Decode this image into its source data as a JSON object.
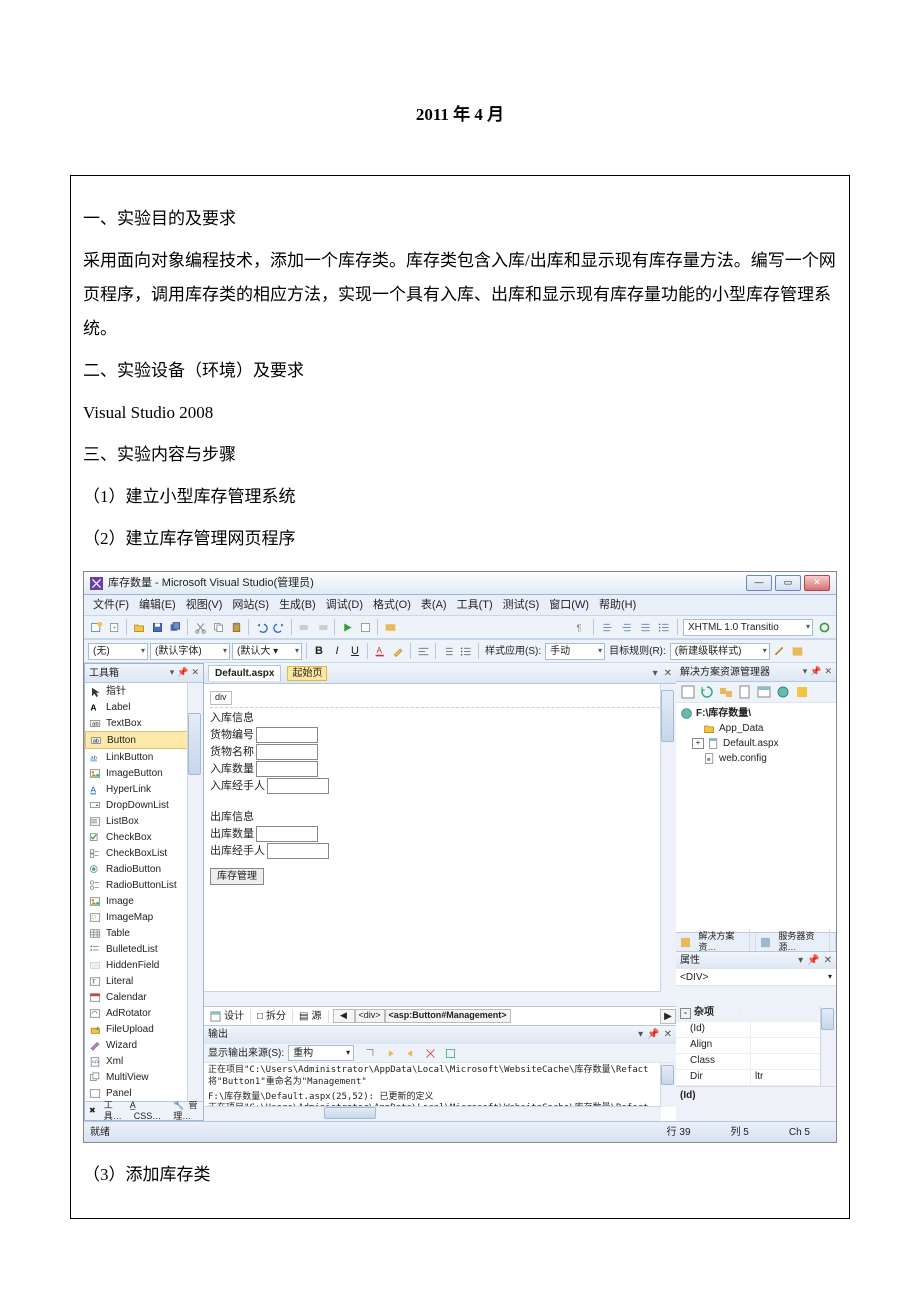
{
  "doc": {
    "date": "2011   年  4    月",
    "h1": "一、实验目的及要求",
    "p1": "采用面向对象编程技术，添加一个库存类。库存类包含入库/出库和显示现有库存量方法。编写一个网页程序，调用库存类的相应方法，实现一个具有入库、出库和显示现有库存量功能的小型库存管理系统。",
    "h2": "二、实验设备（环境）及要求",
    "p2": "Visual Studio 2008",
    "h3": "三、实验内容与步骤",
    "s1": "（1）建立小型库存管理系统",
    "s2": "（2）建立库存管理网页程序",
    "s3": "（3）添加库存类"
  },
  "shot": {
    "title": "库存数量 - Microsoft Visual Studio(管理员)",
    "menu": [
      "文件(F)",
      "编辑(E)",
      "视图(V)",
      "网站(S)",
      "生成(B)",
      "调试(D)",
      "格式(O)",
      "表(A)",
      "工具(T)",
      "测试(S)",
      "窗口(W)",
      "帮助(H)"
    ],
    "tb2": {
      "none": "(无)",
      "font": "(默认字体)",
      "size": "(默认大 ▾",
      "style_label": "样式应用(S):",
      "style_val": "手动",
      "rule_label": "目标规则(R):",
      "rule_val": "(新建级联样式)"
    },
    "tb_right": "XHTML 1.0 Transitio",
    "toolbox": {
      "title": "工具箱",
      "items": [
        "指针",
        "Label",
        "TextBox",
        "Button",
        "LinkButton",
        "ImageButton",
        "HyperLink",
        "DropDownList",
        "ListBox",
        "CheckBox",
        "CheckBoxList",
        "RadioButton",
        "RadioButtonList",
        "Image",
        "ImageMap",
        "Table",
        "BulletedList",
        "HiddenField",
        "Literal",
        "Calendar",
        "AdRotator",
        "FileUpload",
        "Wizard",
        "Xml",
        "MultiView",
        "Panel"
      ],
      "tabs": [
        "工具…",
        "CSS…",
        "管理…"
      ]
    },
    "doc": {
      "tab": "Default.aspx",
      "tab2": "起始页"
    },
    "form": {
      "divtag": "div",
      "l1": "入库信息",
      "l2": "货物编号",
      "l3": "货物名称",
      "l4": "入库数量",
      "l5": "入库经手人",
      "l6": "出库信息",
      "l7": "出库数量",
      "l8": "出库经手人",
      "btn": "库存管理"
    },
    "viewbar": {
      "design": "设计",
      "split": "拆分",
      "source": "源",
      "crumb": [
        "◀",
        "<div>",
        "<asp:Button#Management>"
      ]
    },
    "output": {
      "title": "输出",
      "src_label": "显示输出来源(S):",
      "src_val": "重构",
      "line1": "正在项目\"C:\\Users\\Administrator\\AppData\\Local\\Microsoft\\WebsiteCache\\库存数量\\Refact",
      "line2": "将\"Button1\"重命名为\"Management\"",
      "line3": "F:\\库存数量\\Default.aspx(25,52): 已更新的定义",
      "line4": "正在项目\"C:\\Users\\Administrator\\AppData\\Local\\Microsoft\\WebsiteCache\\库存数量\\Refact"
    },
    "sol": {
      "title": "解决方案资源管理器",
      "root": "F:\\库存数量\\",
      "n1": "App_Data",
      "n2": "Default.aspx",
      "n3": "web.config",
      "tab1": "解决方案资…",
      "tab2": "服务器资源…"
    },
    "prop": {
      "title": "属性",
      "sel": "<DIV>",
      "cat": "杂项",
      "r1": "(Id)",
      "r2": "Align",
      "r3": "Class",
      "r4": "Dir",
      "r4v": "ltr",
      "desc": "(Id)"
    },
    "status": {
      "ready": "就绪",
      "line": "行 39",
      "col": "列 5",
      "ch": "Ch 5"
    }
  }
}
